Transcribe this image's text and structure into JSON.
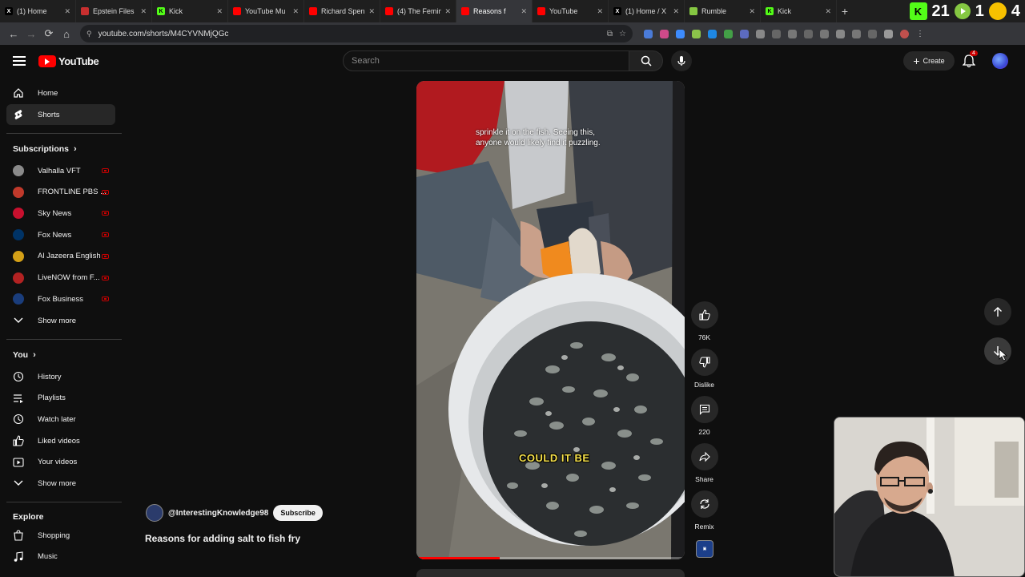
{
  "browser": {
    "tabs": [
      {
        "title": "(1) Home",
        "fav": "x-logo-icon",
        "color": "#000000",
        "glyph": "X",
        "active": false
      },
      {
        "title": "Epstein Files",
        "fav": "page-icon",
        "color": "#c82f2f",
        "glyph": "",
        "active": false
      },
      {
        "title": "Kick",
        "fav": "kick-icon",
        "color": "#53fc18",
        "glyph": "K",
        "active": false
      },
      {
        "title": "YouTube Mu",
        "fav": "youtube-music-icon",
        "color": "#ff0000",
        "glyph": "",
        "active": false
      },
      {
        "title": "Richard Spen",
        "fav": "youtube-icon",
        "color": "#ff0000",
        "glyph": "",
        "active": false
      },
      {
        "title": "(4) The Femin",
        "fav": "youtube-icon",
        "color": "#ff0000",
        "glyph": "",
        "active": false
      },
      {
        "title": "Reasons f",
        "fav": "youtube-icon",
        "color": "#ff0000",
        "glyph": "",
        "active": true
      },
      {
        "title": "YouTube",
        "fav": "youtube-icon",
        "color": "#ff0000",
        "glyph": "",
        "active": false
      },
      {
        "title": "(1) Home / X",
        "fav": "x-logo-icon",
        "color": "#000000",
        "glyph": "X",
        "active": false
      },
      {
        "title": "Rumble",
        "fav": "rumble-icon",
        "color": "#85c742",
        "glyph": "",
        "active": false
      },
      {
        "title": "Kick",
        "fav": "kick-icon",
        "color": "#53fc18",
        "glyph": "K",
        "active": false
      }
    ],
    "new_tab": "+",
    "ext_k": "K",
    "ext_num1": "21",
    "ext_num2": "1",
    "ext_num3": "4",
    "url": "youtube.com/shorts/M4CYVNMjQGc"
  },
  "masthead": {
    "logo_text": "YouTube",
    "search_placeholder": "Search",
    "create_label": "Create",
    "notif_count": "4"
  },
  "sidebar": {
    "main": [
      {
        "label": "Home",
        "icon": "home-icon",
        "active": false
      },
      {
        "label": "Shorts",
        "icon": "shorts-icon",
        "active": true
      }
    ],
    "subscriptions_title": "Subscriptions",
    "subscriptions": [
      {
        "label": "Valhalla VFT",
        "color": "#8a8a8a"
      },
      {
        "label": "FRONTLINE PBS ...",
        "color": "#c0392b"
      },
      {
        "label": "Sky News",
        "color": "#c8102e"
      },
      {
        "label": "Fox News",
        "color": "#003366"
      },
      {
        "label": "Al Jazeera English",
        "color": "#d4a017"
      },
      {
        "label": "LiveNOW from F...",
        "color": "#b22222"
      },
      {
        "label": "Fox Business",
        "color": "#1a3d7c"
      }
    ],
    "show_more": "Show more",
    "you_title": "You",
    "you_items": [
      {
        "label": "History",
        "icon": "history-icon"
      },
      {
        "label": "Playlists",
        "icon": "playlists-icon"
      },
      {
        "label": "Watch later",
        "icon": "watch-later-icon"
      },
      {
        "label": "Liked videos",
        "icon": "like-icon"
      },
      {
        "label": "Your videos",
        "icon": "your-videos-icon"
      }
    ],
    "show_more_2": "Show more",
    "explore_title": "Explore",
    "explore_items": [
      {
        "label": "Shopping",
        "icon": "shopping-icon"
      },
      {
        "label": "Music",
        "icon": "music-icon"
      }
    ]
  },
  "short": {
    "caption_line1": "sprinkle it on the fish. Seeing this,",
    "caption_line2": "anyone would likely find it puzzling.",
    "caption_big": "COULD IT BE",
    "progress_fraction": 0.31,
    "channel_handle": "@InterestingKnowledge98",
    "subscribe_label": "Subscribe",
    "title": "Reasons for adding salt to fish fry"
  },
  "actions": {
    "likes": "76K",
    "dislike": "Dislike",
    "comments": "220",
    "share": "Share",
    "remix": "Remix"
  },
  "colors": {
    "bg": "#0f0f0f",
    "accent_red": "#ff0000",
    "caption_yellow": "#f5e04a"
  }
}
